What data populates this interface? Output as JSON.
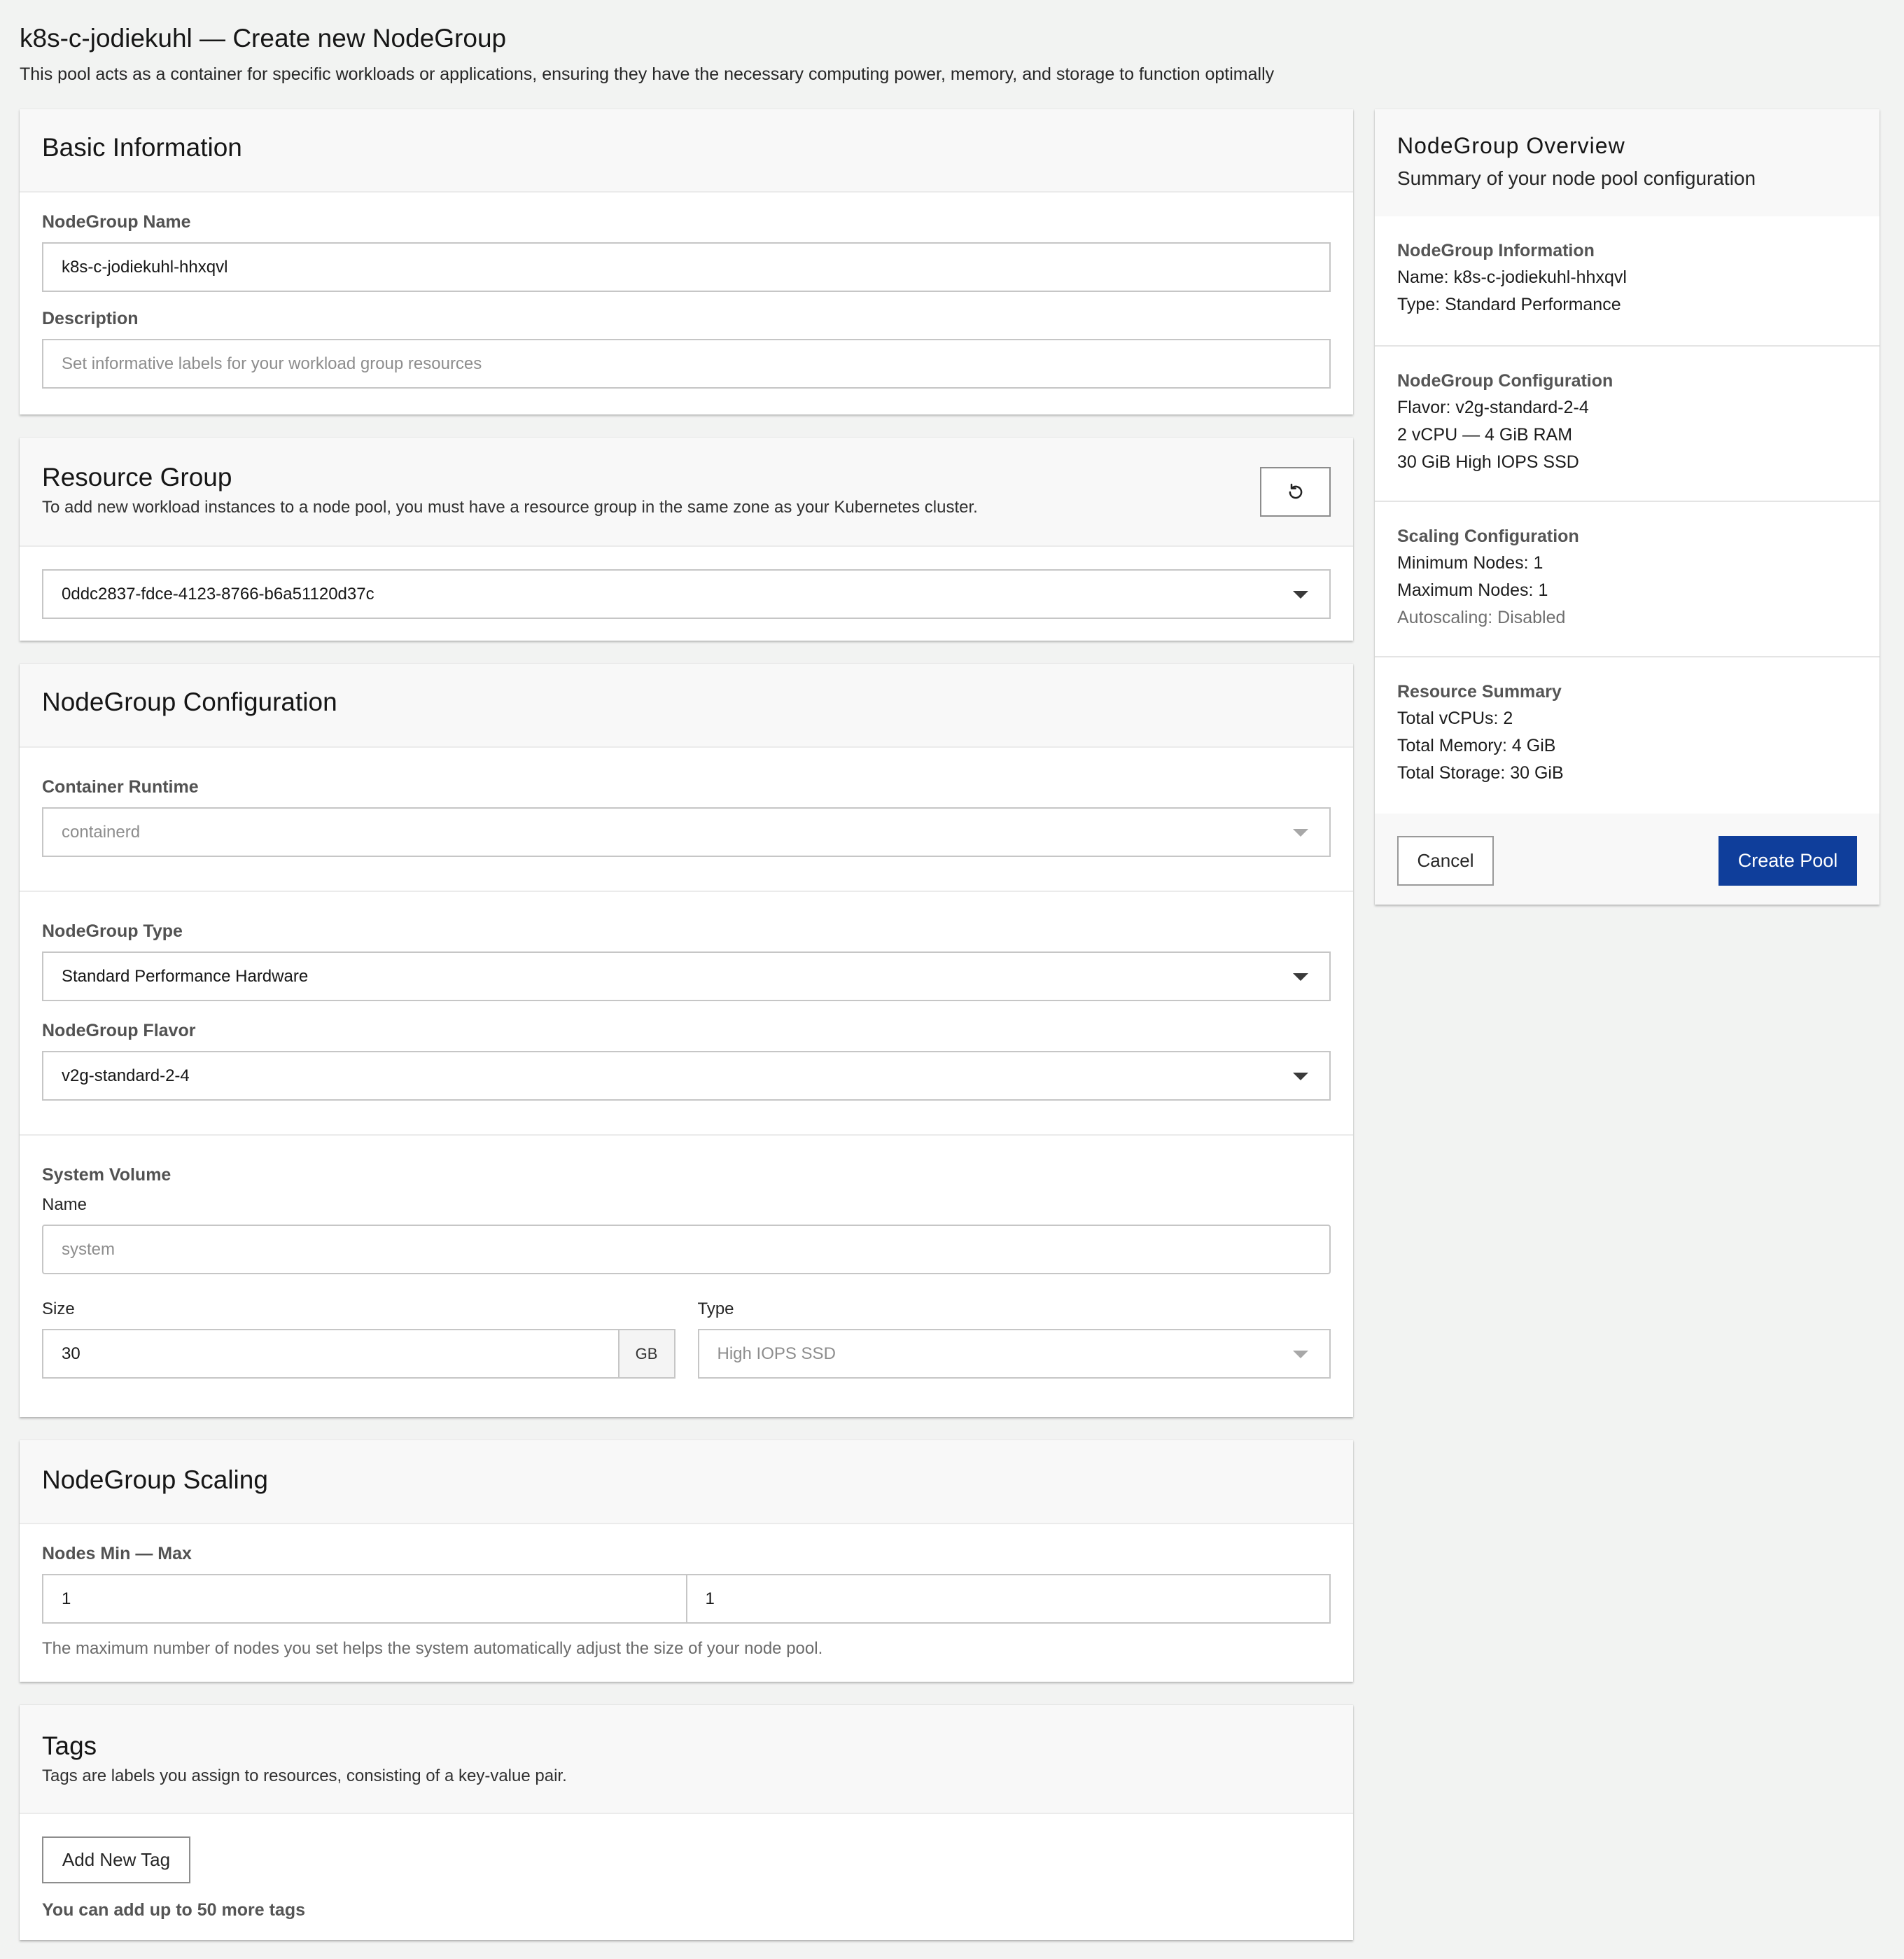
{
  "header": {
    "title": "k8s-c-jodiekuhl — Create new NodeGroup",
    "subtitle": "This pool acts as a container for specific workloads or applications, ensuring they have the necessary computing power, memory, and storage to function optimally"
  },
  "basic": {
    "title": "Basic Information",
    "name_label": "NodeGroup Name",
    "name_value": "k8s-c-jodiekuhl-hhxqvl",
    "desc_label": "Description",
    "desc_placeholder": "Set informative labels for your workload group resources"
  },
  "resource_group": {
    "title": "Resource Group",
    "desc": "To add new workload instances to a node pool, you must have a resource group in the same zone as your Kubernetes cluster.",
    "selected": "0ddc2837-fdce-4123-8766-b6a51120d37c"
  },
  "config": {
    "title": "NodeGroup Configuration",
    "runtime_label": "Container Runtime",
    "runtime_value": "containerd",
    "type_label": "NodeGroup Type",
    "type_value": "Standard Performance Hardware",
    "flavor_label": "NodeGroup Flavor",
    "flavor_value": "v2g-standard-2-4",
    "volume_label": "System Volume",
    "volume_name_label": "Name",
    "volume_name_placeholder": "system",
    "size_label": "Size",
    "size_value": "30",
    "size_unit": "GB",
    "vol_type_label": "Type",
    "vol_type_value": "High IOPS SSD"
  },
  "scaling": {
    "title": "NodeGroup Scaling",
    "label": "Nodes Min — Max",
    "min": "1",
    "max": "1",
    "helper": "The maximum number of nodes you set helps the system automatically adjust the size of your node pool."
  },
  "tags": {
    "title": "Tags",
    "desc": "Tags are labels you assign to resources, consisting of a key-value pair.",
    "add_label": "Add New Tag",
    "limit_text": "You can add up to 50 more tags"
  },
  "overview": {
    "title": "NodeGroup Overview",
    "subtitle": "Summary of your node pool configuration",
    "sections": [
      {
        "heading": "NodeGroup Information",
        "lines": [
          "Name: k8s-c-jodiekuhl-hhxqvl",
          "Type: Standard Performance"
        ]
      },
      {
        "heading": "NodeGroup Configuration",
        "lines": [
          "Flavor: v2g-standard-2-4",
          "2 vCPU — 4 GiB RAM",
          "30 GiB High IOPS SSD"
        ]
      },
      {
        "heading": "Scaling Configuration",
        "lines": [
          "Minimum Nodes: 1",
          "Maximum Nodes: 1",
          "Autoscaling: Disabled"
        ]
      },
      {
        "heading": "Resource Summary",
        "lines": [
          "Total vCPUs: 2",
          "Total Memory: 4 GiB",
          "Total Storage: 30 GiB"
        ]
      }
    ],
    "cancel_label": "Cancel",
    "create_label": "Create Pool"
  },
  "colors": {
    "primary": "#0f3e9b",
    "background": "#f2f3f2"
  },
  "icons": {
    "refresh": "refresh-icon",
    "caret": "chevron-down-icon"
  }
}
